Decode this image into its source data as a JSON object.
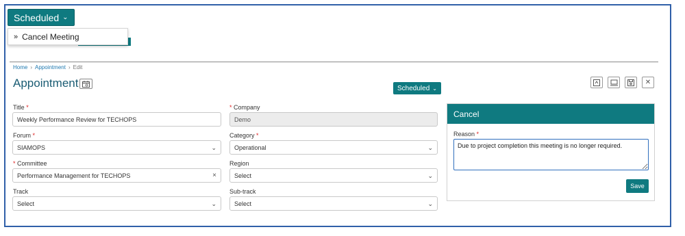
{
  "dropdown": {
    "label": "Scheduled",
    "menu_item": "Cancel Meeting"
  },
  "breadcrumb": {
    "home": "Home",
    "section": "Appointment",
    "current": "Edit"
  },
  "page": {
    "title": "Appointment",
    "status_label": "Scheduled"
  },
  "form": {
    "title": {
      "label": "Title",
      "value": "Weekly Performance Review for TECHOPS"
    },
    "company": {
      "label": "Company",
      "value": "Demo"
    },
    "forum": {
      "label": "Forum",
      "value": "SIAMOPS"
    },
    "category": {
      "label": "Category",
      "value": "Operational"
    },
    "committee": {
      "label": "Committee",
      "value": "Performance Management for TECHOPS"
    },
    "region": {
      "label": "Region",
      "value": "Select"
    },
    "track": {
      "label": "Track",
      "value": "Select"
    },
    "subtrack": {
      "label": "Sub-track",
      "value": "Select"
    }
  },
  "cancel_panel": {
    "title": "Cancel",
    "reason_label": "Reason",
    "reason_value": "Due to project completion this meeting is no longer required.",
    "save_label": "Save"
  },
  "colors": {
    "accent": "#0f7a80",
    "title": "#1a5c73",
    "link": "#1f79b0",
    "required": "#dd2222",
    "frame": "#2f5fa8"
  },
  "icons": [
    "chevron-down-icon",
    "double-chevron-right-icon",
    "calendar-icon",
    "refresh-icon",
    "monitor-icon",
    "save-icon",
    "close-icon",
    "clear-icon"
  ]
}
